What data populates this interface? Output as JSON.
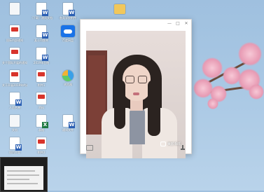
{
  "desktop": {
    "icons": [
      {
        "label": "",
        "type": "doc"
      },
      {
        "label": "（下载）测试文档",
        "type": "word"
      },
      {
        "label": "各类学校附件",
        "type": "word"
      },
      {
        "label": "",
        "type": "folder"
      },
      {
        "label": "国际内部通知",
        "type": "pdf"
      },
      {
        "label": "某公司版本",
        "type": "word"
      },
      {
        "label": "百度网盘",
        "type": "cloud"
      },
      {
        "label": "关于国际开展的通知",
        "type": "pdf"
      },
      {
        "label": "2019年总结",
        "type": "word"
      },
      {
        "label": "关于开展2019年的通知",
        "type": "pdf"
      },
      {
        "label": "附件1",
        "type": "pdf"
      },
      {
        "label": "浏览器",
        "type": "browser"
      },
      {
        "label": "人员名单",
        "type": "word"
      },
      {
        "label": "资料",
        "type": "pdf"
      },
      {
        "label": "文档",
        "type": "doc"
      },
      {
        "label": "表格",
        "type": "excel"
      },
      {
        "label": "通知文件",
        "type": "word"
      },
      {
        "label": "附件2",
        "type": "pdf"
      },
      {
        "label": "项目方案",
        "type": "word"
      }
    ]
  },
  "video_window": {
    "minimize": "—",
    "maximize": "□",
    "close": "✕",
    "watermark": "美颜相机"
  },
  "colors": {
    "wallpaper": "#a9c8e4",
    "window": "#ffffff",
    "pdf_red": "#d8342b",
    "word_blue": "#2b5fb3"
  }
}
